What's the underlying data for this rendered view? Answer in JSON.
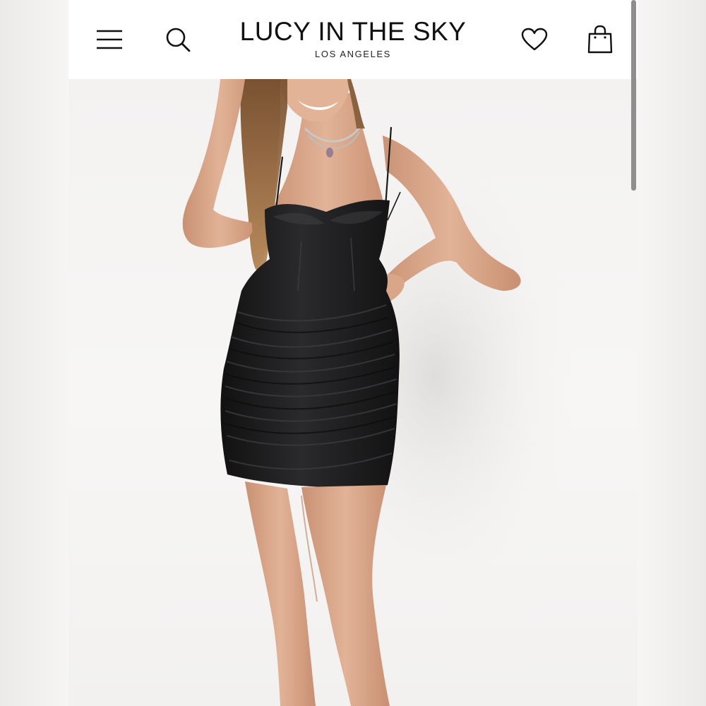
{
  "header": {
    "brand_name": "LUCY IN THE SKY",
    "brand_subtitle": "LOS ANGELES",
    "icons": [
      "menu-icon",
      "search-icon",
      "heart-icon",
      "shopping-bag-icon"
    ]
  },
  "colors": {
    "header_bg": "#ffffff",
    "text": "#111111",
    "dress": "#1b1b1c",
    "skin": "#d9a688",
    "backdrop": "#f4f3f2"
  }
}
